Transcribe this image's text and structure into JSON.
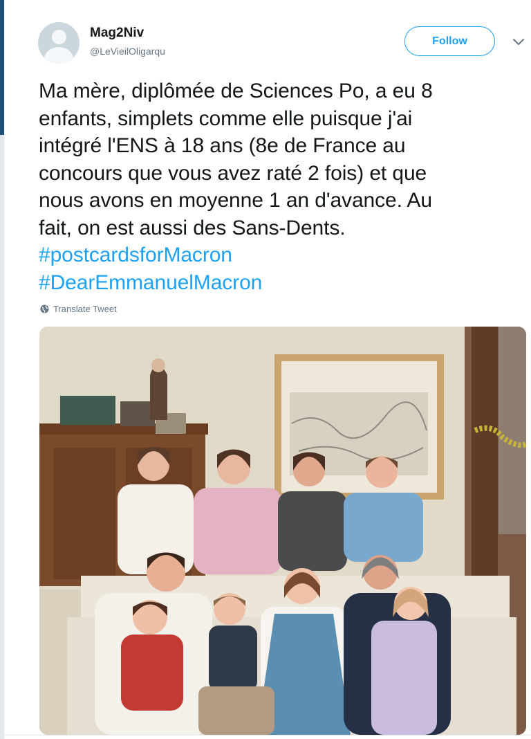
{
  "author": {
    "name": "Mag2Niv",
    "handle": "@LeVieilOligarqu"
  },
  "follow_button": {
    "label": "Follow"
  },
  "tweet": {
    "lines": [
      "Ma mère, diplômée de Sciences Po, a eu 8",
      "enfants, simplets comme elle puisque j'ai",
      "intégré l'ENS à 18 ans (8e de France au",
      "concours que vous avez raté 2 fois) et que",
      "nous avons en moyenne 1 an d'avance. Au",
      "fait, on est aussi des Sans-Dents."
    ],
    "hashtags": [
      "#postcardsforMacron",
      "#DearEmmanuelMacron"
    ]
  },
  "translate": {
    "label": "Translate Tweet",
    "icon": "globe-icon"
  },
  "media": {
    "alt": "family-photo",
    "icon": "photo"
  },
  "colors": {
    "link": "#1da1f2",
    "text": "#14171a",
    "muted": "#657786",
    "sidebar_accent": "#1c4f7a"
  }
}
